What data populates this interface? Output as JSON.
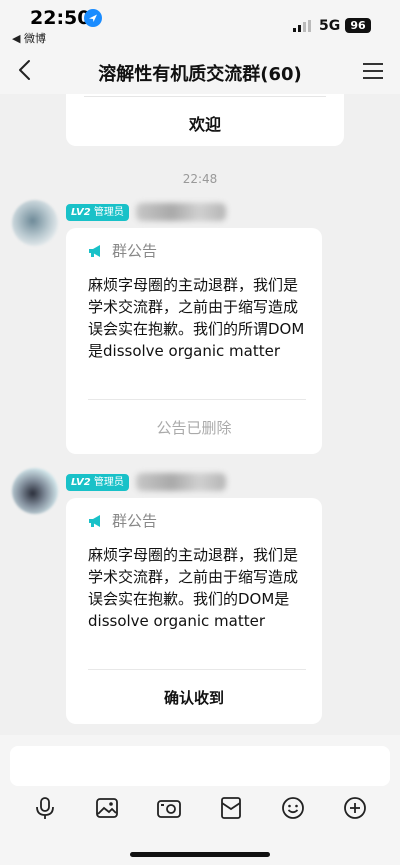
{
  "status_bar": {
    "time": "22:50",
    "back_app": "◀ 微博",
    "network": "5G",
    "battery": "96"
  },
  "nav": {
    "title": "溶解性有机质交流群(60)"
  },
  "messages": {
    "welcome_text": "欢迎",
    "timestamp": "22:48",
    "notice1": {
      "badge_level": "LV2",
      "badge_role": "管理员",
      "header": "群公告",
      "body": "麻烦字母圈的主动退群，我们是学术交流群，之前由于缩写造成误会实在抱歉。我们的所谓DOM是dissolve organic matter",
      "footer": "公告已删除"
    },
    "notice2": {
      "badge_level": "LV2",
      "badge_role": "管理员",
      "header": "群公告",
      "body": "麻烦字母圈的主动退群，我们是学术交流群，之前由于缩写造成误会实在抱歉。我们的DOM是dissolve organic matter",
      "footer": "确认收到"
    }
  },
  "colors": {
    "badge": "#19c1c8",
    "megaphone": "#19c1c8",
    "location": "#1a8cff"
  },
  "icons": {
    "toolbar": [
      "microphone-icon",
      "image-icon",
      "camera-icon",
      "red-packet-icon",
      "emoji-icon",
      "plus-icon"
    ]
  }
}
